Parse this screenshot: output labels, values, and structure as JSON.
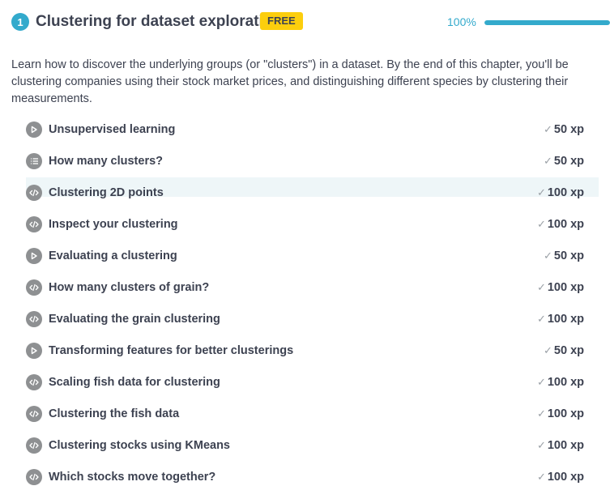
{
  "chapter": {
    "number": "1",
    "title": "Clustering for dataset exploration",
    "badge": "FREE",
    "progress_label": "100%",
    "progress_value": 1.0,
    "description": "Learn how to discover the underlying groups (or \"clusters\") in a dataset. By the end of this chapter, you'll be clustering companies using their stock market prices, and distinguishing different species by clustering their measurements."
  },
  "colors": {
    "accent": "#33aacc",
    "badge": "#fcce0d",
    "icon_bg": "#8e9092",
    "active_row": "#eef6f8",
    "text": "#3d4251"
  },
  "exercises": [
    {
      "title": "Unsupervised learning",
      "xp": "50 xp",
      "icon": "play-icon",
      "done": true
    },
    {
      "title": "How many clusters?",
      "xp": "50 xp",
      "icon": "list-icon",
      "done": true
    },
    {
      "title": "Clustering 2D points",
      "xp": "100 xp",
      "icon": "code-icon",
      "done": true,
      "active": true
    },
    {
      "title": "Inspect your clustering",
      "xp": "100 xp",
      "icon": "code-icon",
      "done": true
    },
    {
      "title": "Evaluating a clustering",
      "xp": "50 xp",
      "icon": "play-icon",
      "done": true
    },
    {
      "title": "How many clusters of grain?",
      "xp": "100 xp",
      "icon": "code-icon",
      "done": true
    },
    {
      "title": "Evaluating the grain clustering",
      "xp": "100 xp",
      "icon": "code-icon",
      "done": true
    },
    {
      "title": "Transforming features for better clusterings",
      "xp": "50 xp",
      "icon": "play-icon",
      "done": true
    },
    {
      "title": "Scaling fish data for clustering",
      "xp": "100 xp",
      "icon": "code-icon",
      "done": true
    },
    {
      "title": "Clustering the fish data",
      "xp": "100 xp",
      "icon": "code-icon",
      "done": true
    },
    {
      "title": "Clustering stocks using KMeans",
      "xp": "100 xp",
      "icon": "code-icon",
      "done": true
    },
    {
      "title": "Which stocks move together?",
      "xp": "100 xp",
      "icon": "code-icon",
      "done": true
    }
  ],
  "check_glyph": "✓"
}
